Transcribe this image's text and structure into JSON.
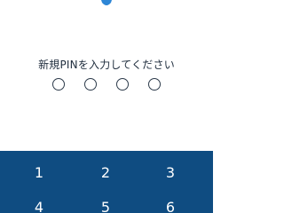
{
  "header": {
    "logo_icon": "shield-logo-icon",
    "logo_color": "#2e86d6"
  },
  "prompt": {
    "text": "新規PINを入力してください"
  },
  "pin": {
    "length": 4,
    "entered": 0
  },
  "keypad": {
    "background": "#0f4c81",
    "keys": [
      "1",
      "2",
      "3",
      "4",
      "5",
      "6"
    ]
  }
}
